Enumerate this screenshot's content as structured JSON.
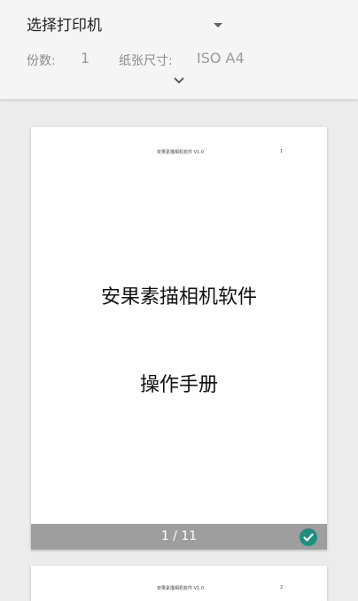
{
  "header": {
    "printer_select_label": "选择打印机",
    "copies_label": "份数:",
    "copies_value": "1",
    "paper_size_label": "纸张尺寸:",
    "paper_size_value": "ISO A4"
  },
  "preview": {
    "pages": [
      {
        "running_header": "安果素描相机软件 V1.0",
        "page_number": "1",
        "title": "安果素描相机软件",
        "subtitle": "操作手册",
        "counter": "1 / 11",
        "selected": true
      },
      {
        "running_header": "安果素描相机软件 V1.0",
        "page_number": "2"
      }
    ]
  },
  "colors": {
    "check_accent": "#1e8f7e",
    "footer_bar": "#9e9e9e",
    "toolbar_bg": "#f5f5f5",
    "preview_bg": "#ececec"
  }
}
